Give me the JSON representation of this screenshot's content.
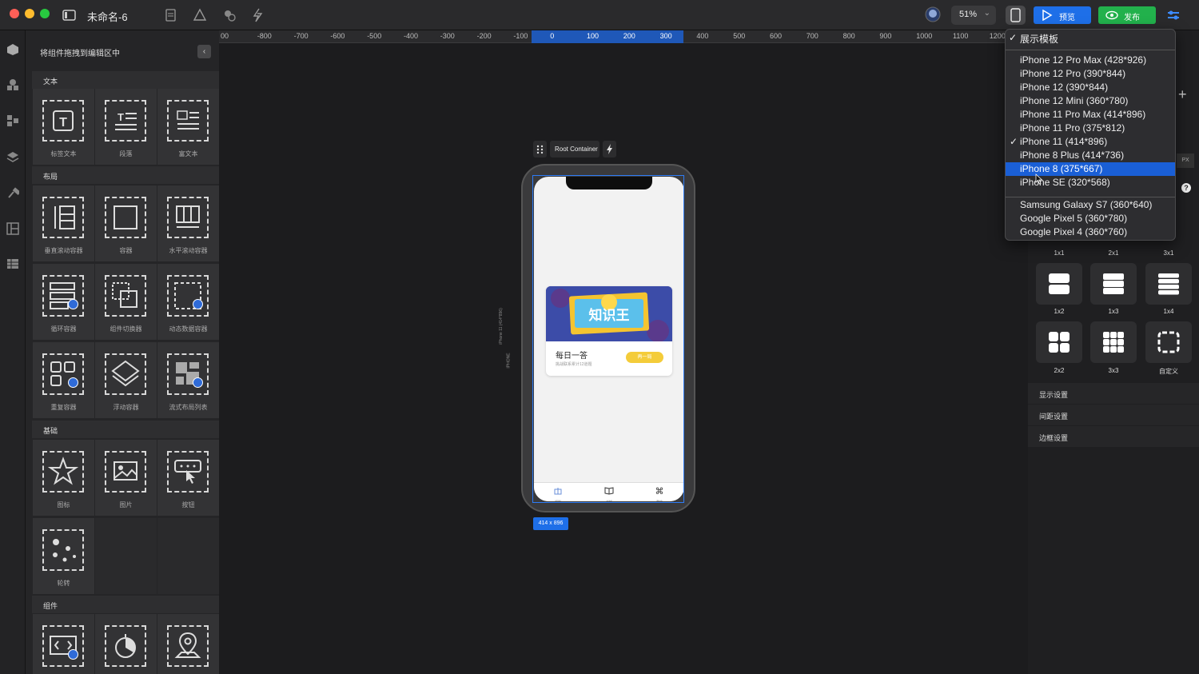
{
  "window": {
    "title": "未命名-6",
    "zoom": "51%"
  },
  "toolbar": {
    "preview_label": "预览",
    "publish_label": "发布"
  },
  "component_panel": {
    "title": "将组件拖拽到编辑区中",
    "sections": [
      {
        "name": "文本",
        "items": [
          "标签文本",
          "段落",
          "富文本"
        ]
      },
      {
        "name": "布局",
        "items": [
          "垂直滚动容器",
          "容器",
          "水平滚动容器",
          "循环容器",
          "组件切换器",
          "动态数据容器",
          "重复容器",
          "浮动容器",
          "流式布局列表"
        ]
      },
      {
        "name": "基础",
        "items": [
          "图标",
          "图片",
          "按钮",
          "轮转"
        ]
      },
      {
        "name": "组件",
        "items": []
      }
    ]
  },
  "ruler": {
    "labels": [
      "00",
      "-800",
      "-700",
      "-600",
      "-500",
      "-400",
      "-300",
      "-200",
      "-100",
      "0",
      "100",
      "200",
      "300",
      "400",
      "500",
      "600",
      "700",
      "800",
      "900",
      "1000",
      "1100",
      "1200"
    ]
  },
  "canvas": {
    "root_label": "Root Container",
    "size_tag": "414 x 896",
    "vertical_labels": [
      "iPhone 11 (414*896)",
      "IPHONE"
    ],
    "card": {
      "title": "每日一答",
      "subtitle": "挑战联系累计12道题",
      "button": "再一局",
      "banner_text": "知识王"
    },
    "tabbar": [
      "福利",
      "书城",
      "我的"
    ]
  },
  "right_panel": {
    "px_label": "PX",
    "layouts": [
      "1x1",
      "2x1",
      "3x1",
      "1x2",
      "1x3",
      "1x4",
      "2x2",
      "3x3",
      "自定义"
    ],
    "settings": [
      "显示设置",
      "间距设置",
      "边框设置"
    ]
  },
  "device_dropdown": {
    "header": "展示模板",
    "groups": [
      [
        "iPhone 12 Pro Max (428*926)",
        "iPhone 12 Pro (390*844)",
        "iPhone 12 (390*844)",
        "iPhone 12 Mini (360*780)",
        "iPhone 11 Pro Max (414*896)",
        "iPhone 11 Pro (375*812)",
        "iPhone 11 (414*896)",
        "iPhone 8 Plus (414*736)",
        "iPhone 8 (375*667)",
        "iPhone SE (320*568)"
      ],
      [
        "Samsung Galaxy S7 (360*640)",
        "Google Pixel 5 (360*780)",
        "Google Pixel 4 (360*760)"
      ]
    ],
    "checked": "iPhone 11 (414*896)",
    "highlighted": "iPhone 8 (375*667)"
  },
  "colors": {
    "accent": "#1e6fe8",
    "publish": "#22b14c",
    "highlight": "#1a5fd6"
  }
}
